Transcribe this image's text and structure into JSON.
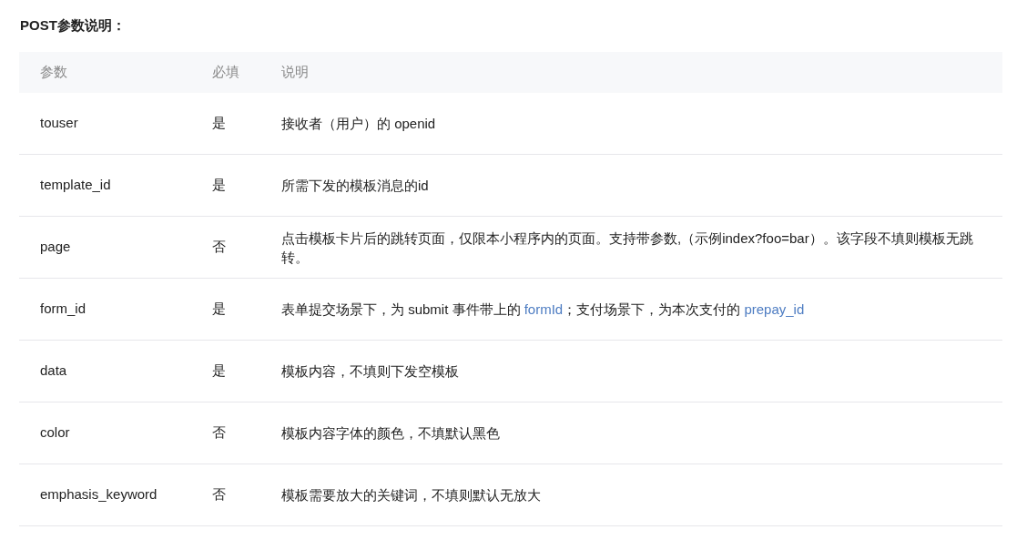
{
  "title": "POST参数说明：",
  "table": {
    "columns": [
      "参数",
      "必填",
      "说明"
    ],
    "rows": [
      {
        "param": "touser",
        "required": "是",
        "description": [
          {
            "kind": "text",
            "text": "接收者（用户）的 openid"
          }
        ]
      },
      {
        "param": "template_id",
        "required": "是",
        "description": [
          {
            "kind": "text",
            "text": "所需下发的模板消息的id"
          }
        ]
      },
      {
        "param": "page",
        "required": "否",
        "description": [
          {
            "kind": "text",
            "text": "点击模板卡片后的跳转页面，仅限本小程序内的页面。支持带参数,（示例index?foo=bar）。该字段不填则模板无跳转。"
          }
        ]
      },
      {
        "param": "form_id",
        "required": "是",
        "description": [
          {
            "kind": "text",
            "text": "表单提交场景下，为 submit 事件带上的 "
          },
          {
            "kind": "link",
            "text": "formId"
          },
          {
            "kind": "text",
            "text": "；支付场景下，为本次支付的 "
          },
          {
            "kind": "link",
            "text": "prepay_id"
          }
        ]
      },
      {
        "param": "data",
        "required": "是",
        "description": [
          {
            "kind": "text",
            "text": "模板内容，不填则下发空模板"
          }
        ]
      },
      {
        "param": "color",
        "required": "否",
        "description": [
          {
            "kind": "text",
            "text": "模板内容字体的颜色，不填默认黑色"
          }
        ]
      },
      {
        "param": "emphasis_keyword",
        "required": "否",
        "description": [
          {
            "kind": "text",
            "text": "模板需要放大的关键词，不填则默认无放大"
          }
        ]
      }
    ]
  }
}
